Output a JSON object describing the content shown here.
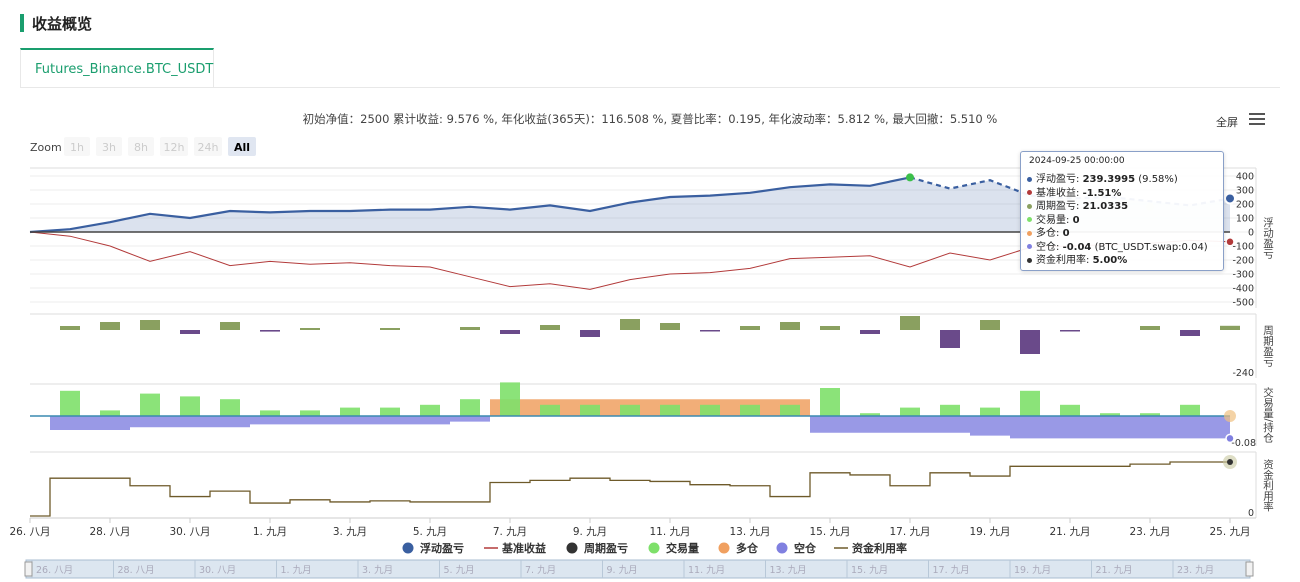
{
  "header": {
    "title": "收益概览"
  },
  "tabs": [
    {
      "label": "Futures_Binance.BTC_USDT"
    }
  ],
  "summary": "初始净值：2500 累计收益: 9.576 %, 年化收益(365天)：116.508 %, 夏普比率：0.195, 年化波动率：5.812 %, 最大回撤：5.510 %",
  "toolbar": {
    "fullscreen": "全屏",
    "menu_icon": "hamburger-menu-icon"
  },
  "zoom": {
    "label": "Zoom",
    "buttons": [
      "1h",
      "3h",
      "8h",
      "12h",
      "24h",
      "All"
    ],
    "selected": "All"
  },
  "tooltip": {
    "time": "2024-09-25 00:00:00",
    "rows": [
      {
        "name": "浮动盈亏",
        "value": "239.3995",
        "extra": " (9.58%)",
        "color": "#3a5fa0"
      },
      {
        "name": "基准收益",
        "value": "-1.51%",
        "extra": "",
        "color": "#b23a3a"
      },
      {
        "name": "周期盈亏",
        "value": "21.0335",
        "extra": "",
        "color": "#8aa060"
      },
      {
        "name": "交易量",
        "value": "0",
        "extra": "",
        "color": "#7ee06a"
      },
      {
        "name": "多仓",
        "value": "0",
        "extra": "",
        "color": "#f0a060"
      },
      {
        "name": "空仓",
        "value": "-0.04",
        "extra": " (BTC_USDT.swap:0.04)",
        "color": "#8080e0"
      },
      {
        "name": "资金利用率",
        "value": "5.00%",
        "extra": "",
        "color": "#333333"
      }
    ]
  },
  "chart_data": {
    "type": "line",
    "x": [
      "08-26",
      "08-27",
      "08-28",
      "08-29",
      "08-30",
      "08-31",
      "09-01",
      "09-02",
      "09-03",
      "09-04",
      "09-05",
      "09-06",
      "09-07",
      "09-08",
      "09-09",
      "09-10",
      "09-11",
      "09-12",
      "09-13",
      "09-14",
      "09-15",
      "09-16",
      "09-17",
      "09-18",
      "09-19",
      "09-20",
      "09-21",
      "09-22",
      "09-23",
      "09-24",
      "09-25"
    ],
    "x_tick_labels": [
      "26. 八月",
      "28. 八月",
      "30. 八月",
      "1. 九月",
      "3. 九月",
      "5. 九月",
      "7. 九月",
      "9. 九月",
      "11. 九月",
      "13. 九月",
      "15. 九月",
      "17. 九月",
      "19. 九月",
      "21. 九月",
      "23. 九月",
      "25. 九月"
    ],
    "navigator_labels": [
      "26. 八月",
      "28. 八月",
      "30. 八月",
      "1. 九月",
      "3. 九月",
      "5. 九月",
      "7. 九月",
      "9. 九月",
      "11. 九月",
      "13. 九月",
      "15. 九月",
      "17. 九月",
      "19. 九月",
      "21. 九月",
      "23. 九月"
    ],
    "panels": [
      {
        "axis_title": "浮动盈亏",
        "ticks": [
          "400",
          "300",
          "200",
          "100",
          "0",
          "-100",
          "-200",
          "-300",
          "-400",
          "-500"
        ],
        "ylim": [
          -500,
          400
        ]
      },
      {
        "axis_title": "周期盈亏",
        "ticks": [
          "-240"
        ]
      },
      {
        "axis_title": "交易量/持仓",
        "ticks": [
          "-0.08"
        ]
      },
      {
        "axis_title": "资金利用率",
        "ticks": [
          "0"
        ]
      }
    ],
    "series": [
      {
        "name": "浮动盈亏",
        "color": "#3a5fa0",
        "values": [
          0,
          20,
          70,
          130,
          100,
          150,
          140,
          150,
          150,
          160,
          160,
          180,
          160,
          190,
          150,
          210,
          250,
          260,
          280,
          320,
          340,
          330,
          390,
          310,
          370,
          260,
          240,
          250,
          220,
          190,
          239.4
        ]
      },
      {
        "name": "基准收益",
        "color": "#b23a3a",
        "values": [
          0,
          -30,
          -100,
          -210,
          -140,
          -240,
          -210,
          -230,
          -220,
          -240,
          -250,
          -320,
          -390,
          -370,
          -410,
          -340,
          -300,
          -290,
          -260,
          -190,
          -180,
          -170,
          -250,
          -150,
          -200,
          -110,
          -100,
          -90,
          -80,
          -60,
          -70
        ]
      },
      {
        "name": "周期盈亏",
        "color": "#8aa060",
        "negative_color": "#6a4a8a",
        "values": [
          0,
          20,
          40,
          50,
          -20,
          40,
          -8,
          10,
          0,
          10,
          0,
          15,
          -20,
          25,
          -35,
          55,
          35,
          -5,
          20,
          40,
          20,
          -20,
          70,
          -90,
          50,
          -120,
          -5,
          0,
          20,
          -30,
          21.03
        ]
      },
      {
        "name": "交易量",
        "color": "#7ee06a",
        "values": [
          0,
          0.045,
          0.01,
          0.04,
          0.035,
          0.03,
          0.01,
          0.01,
          0.015,
          0.015,
          0.02,
          0.03,
          0.06,
          0.02,
          0.02,
          0.02,
          0.02,
          0.02,
          0.02,
          0.02,
          0.05,
          0.005,
          0.015,
          0.02,
          0.015,
          0.045,
          0.02,
          0.005,
          0.005,
          0.02,
          0
        ]
      },
      {
        "name": "多仓",
        "color": "#f0a060",
        "values": [
          0,
          0,
          0,
          0,
          0,
          0,
          0,
          0,
          0,
          0,
          0,
          0,
          0.03,
          0.03,
          0.03,
          0.03,
          0.03,
          0.03,
          0.03,
          0.03,
          0,
          0,
          0,
          0,
          0,
          0,
          0,
          0,
          0,
          0,
          0
        ]
      },
      {
        "name": "空仓",
        "color": "#8080e0",
        "values": [
          0,
          -0.025,
          -0.025,
          -0.02,
          -0.02,
          -0.02,
          -0.015,
          -0.015,
          -0.015,
          -0.015,
          -0.015,
          -0.01,
          0,
          0,
          0,
          0,
          0,
          0,
          0,
          0,
          -0.03,
          -0.03,
          -0.03,
          -0.03,
          -0.035,
          -0.04,
          -0.04,
          -0.04,
          -0.04,
          -0.04,
          -0.04
        ]
      },
      {
        "name": "资金利用率",
        "color": "#6e5a2a",
        "values": [
          0,
          0.035,
          0.035,
          0.028,
          0.018,
          0.023,
          0.012,
          0.015,
          0.013,
          0.014,
          0.013,
          0.013,
          0.031,
          0.033,
          0.035,
          0.033,
          0.032,
          0.029,
          0.028,
          0.018,
          0.04,
          0.038,
          0.028,
          0.04,
          0.037,
          0.046,
          0.046,
          0.046,
          0.048,
          0.05,
          0.05
        ]
      }
    ]
  }
}
